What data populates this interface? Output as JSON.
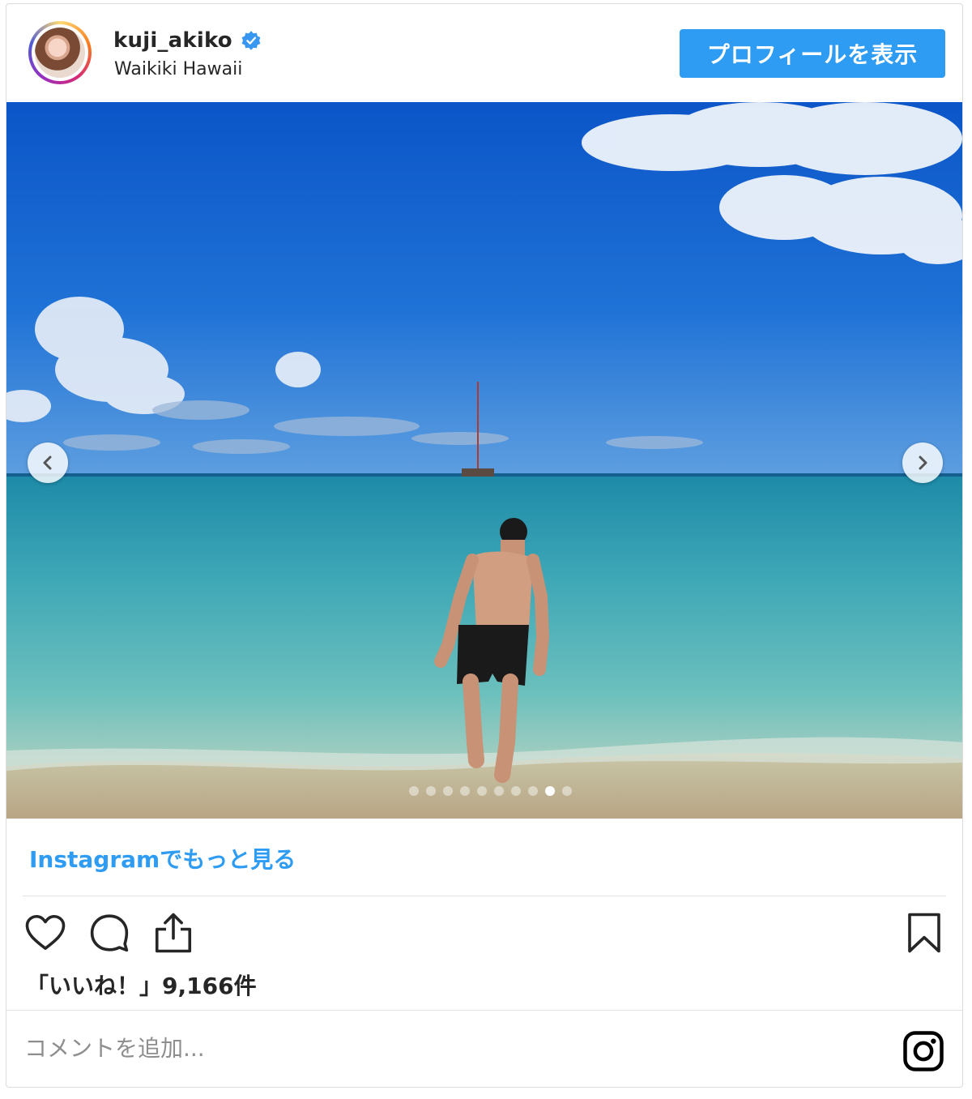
{
  "header": {
    "username": "kuji_akiko",
    "location": "Waikiki Hawaii",
    "profile_button_label": "プロフィールを表示",
    "verified_icon": "verified-badge-icon"
  },
  "carousel": {
    "dot_count": 10,
    "active_dot": 9,
    "prev_icon": "chevron-left-icon",
    "next_icon": "chevron-right-icon"
  },
  "more_link": "Instagramでもっと見る",
  "actions": {
    "like_icon": "heart-icon",
    "comment_icon": "comment-icon",
    "share_icon": "share-icon",
    "save_icon": "bookmark-icon"
  },
  "likes_text": "「いいね！」9,166件",
  "comment": {
    "placeholder": "コメントを追加..."
  },
  "colors": {
    "accent": "#2f9cf3",
    "text": "#262626",
    "muted": "#8e8e8e"
  }
}
